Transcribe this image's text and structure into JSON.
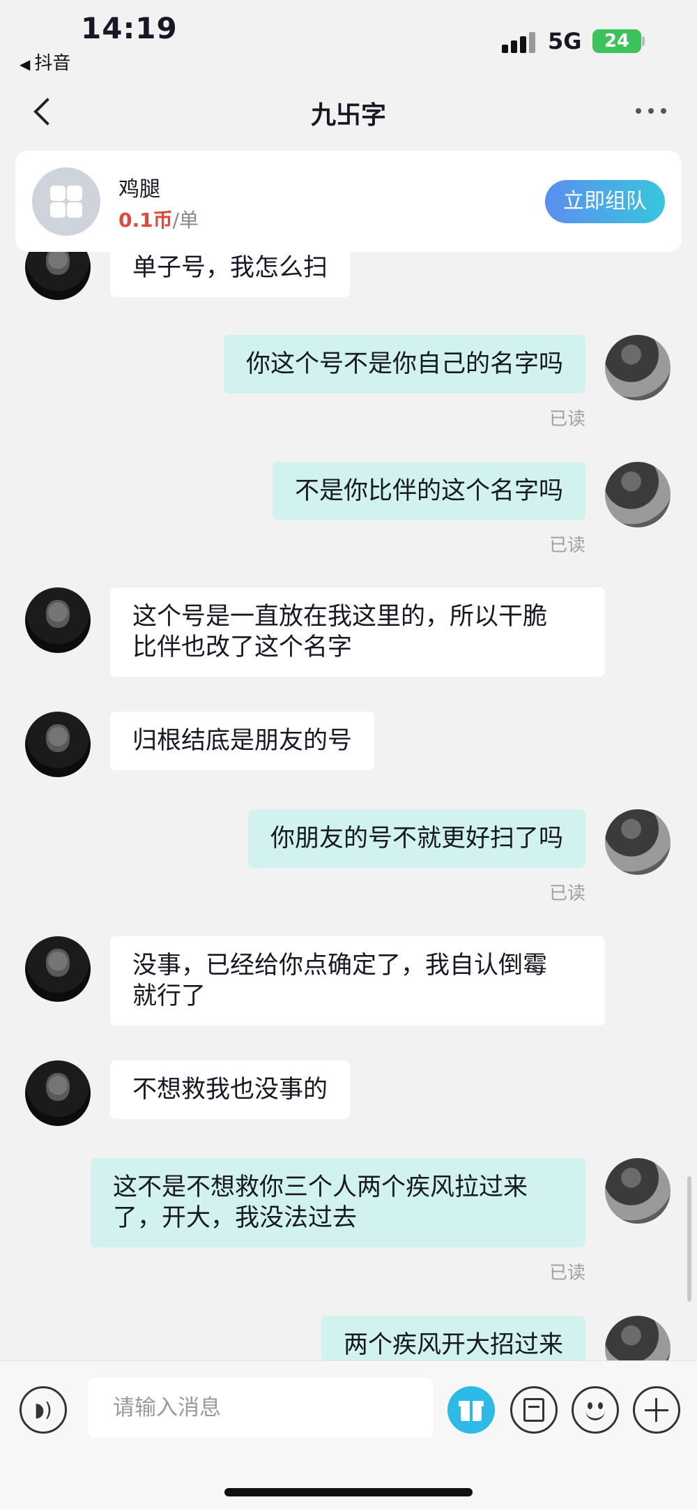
{
  "status_bar": {
    "time": "14:19",
    "back_app": "抖音",
    "network": "5G",
    "battery": "24"
  },
  "header": {
    "title": "九卐字"
  },
  "order_card": {
    "name": "鸡腿",
    "price": "0.1币",
    "unit": "/单",
    "action": "立即组队"
  },
  "messages": [
    {
      "side": "left",
      "text": "单子号，我怎么扫"
    },
    {
      "side": "right",
      "text": "你这个号不是你自己的名字吗",
      "status": "已读"
    },
    {
      "side": "right",
      "text": "不是你比伴的这个名字吗",
      "status": "已读"
    },
    {
      "side": "left",
      "text": "这个号是一直放在我这里的，所以干脆\n比伴也改了这个名字"
    },
    {
      "side": "left",
      "text": "归根结底是朋友的号"
    },
    {
      "side": "right",
      "text": "你朋友的号不就更好扫了吗",
      "status": "已读"
    },
    {
      "side": "left",
      "text": "没事，已经给你点确定了，我自认倒霉\n就行了"
    },
    {
      "side": "left",
      "text": "不想救我也没事的"
    },
    {
      "side": "right",
      "text": "这不是不想救你三个人两个疾风拉过来\n了，开大，我没法过去",
      "status": "已读"
    },
    {
      "side": "right",
      "text": "两个疾风开大招过来"
    }
  ],
  "input_bar": {
    "placeholder": "请输入消息"
  },
  "icons": [
    "voice-icon",
    "gift-icon",
    "order-card-icon",
    "emoji-icon",
    "plus-icon",
    "back-icon",
    "more-icon"
  ],
  "colors": {
    "background": "#f2f2f2",
    "self_bubble": "#d2f2ef",
    "other_bubble": "#ffffff",
    "price": "#e0483e",
    "team_button_from": "#5b8ef0",
    "team_button_to": "#38c6dd",
    "gift": "#2cbbe8"
  }
}
